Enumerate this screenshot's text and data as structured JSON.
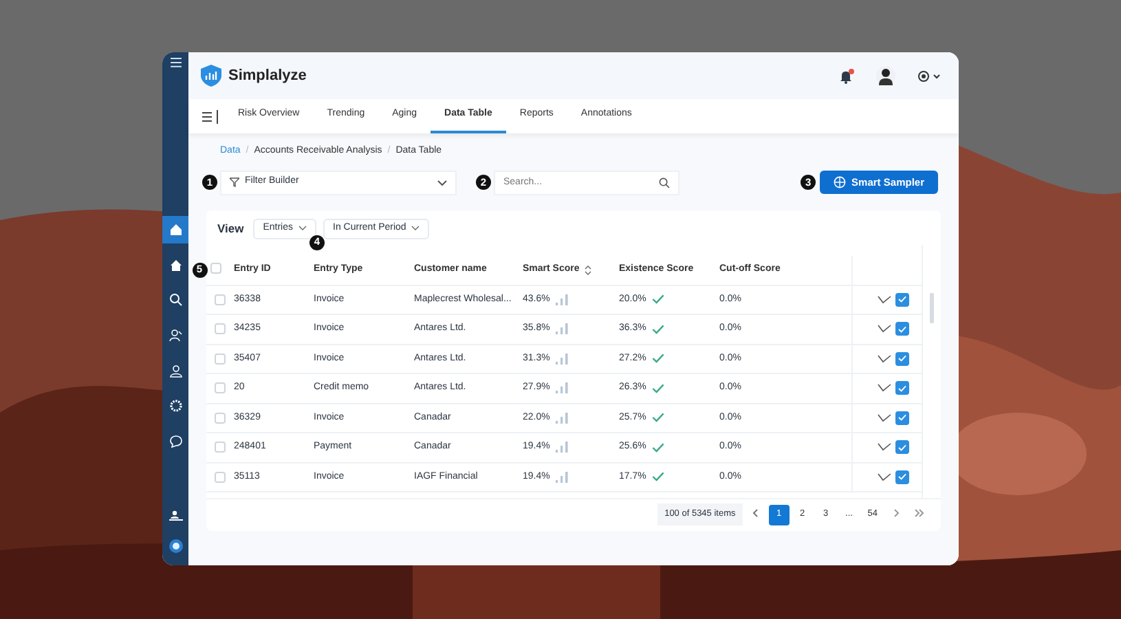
{
  "sidebar": {
    "items": [
      {
        "kind": "top",
        "selected": true
      },
      {
        "kind": "home",
        "selected": false
      },
      {
        "kind": "search",
        "selected": false
      },
      {
        "kind": "users",
        "selected": false
      },
      {
        "kind": "user",
        "selected": false
      },
      {
        "kind": "gear",
        "selected": false
      },
      {
        "kind": "chat",
        "selected": false
      },
      {
        "kind": "people",
        "selected": false
      }
    ]
  },
  "header": {
    "app_name": "Simplalyze",
    "notifications_unread": true
  },
  "tabs": [
    {
      "label": "Risk Overview",
      "selected": false
    },
    {
      "label": "Trending",
      "selected": false
    },
    {
      "label": "Aging",
      "selected": false
    },
    {
      "label": "Data Table",
      "selected": true
    },
    {
      "label": "Reports",
      "selected": false
    },
    {
      "label": "Annotations",
      "selected": false
    }
  ],
  "breadcrumb": {
    "separator": "/",
    "items": [
      "Data",
      "Accounts Receivable Analysis",
      "Data Table"
    ]
  },
  "filter": {
    "label": "Filter Builder"
  },
  "search": {
    "placeholder": "Search..."
  },
  "primary_button": "Smart Sampler",
  "markers": [
    "1",
    "2",
    "3",
    "4",
    "5"
  ],
  "view": {
    "label": "View",
    "dropdowns": [
      "Entries",
      "In Current Period"
    ]
  },
  "table": {
    "select_all_checked": false,
    "columns": [
      {
        "label": "Entry ID",
        "sortable": false
      },
      {
        "label": "Entry Type",
        "sortable": false
      },
      {
        "label": "Customer name",
        "sortable": false
      },
      {
        "label": "Smart Score",
        "sortable": true
      },
      {
        "label": "Existence Score",
        "sortable": false
      },
      {
        "label": "Cut-off Score",
        "sortable": false
      }
    ],
    "rows": [
      {
        "checked": false,
        "cells": [
          "36338",
          "Invoice",
          "Maplecrest Wholesal...",
          "43.6%",
          "20.0%",
          "0.0%"
        ],
        "approved": true
      },
      {
        "checked": false,
        "cells": [
          "34235",
          "Invoice",
          "Antares Ltd.",
          "35.8%",
          "36.3%",
          "0.0%"
        ],
        "approved": true
      },
      {
        "checked": false,
        "cells": [
          "35407",
          "Invoice",
          "Antares Ltd.",
          "31.3%",
          "27.2%",
          "0.0%"
        ],
        "approved": true
      },
      {
        "checked": false,
        "cells": [
          "20",
          "Credit memo",
          "Antares Ltd.",
          "27.9%",
          "26.3%",
          "0.0%"
        ],
        "approved": true
      },
      {
        "checked": false,
        "cells": [
          "36329",
          "Invoice",
          "Canadar",
          "22.0%",
          "25.7%",
          "0.0%"
        ],
        "approved": true
      },
      {
        "checked": false,
        "cells": [
          "248401",
          "Payment",
          "Canadar",
          "19.4%",
          "25.6%",
          "0.0%"
        ],
        "approved": true
      },
      {
        "checked": false,
        "cells": [
          "35113",
          "Invoice",
          "IAGF Financial",
          "19.4%",
          "17.7%",
          "0.0%"
        ],
        "approved": true
      }
    ]
  },
  "pagination": {
    "summary": "100 of 5345 items",
    "pages": [
      {
        "label": "1",
        "selected": true
      },
      {
        "label": "2",
        "selected": false
      },
      {
        "label": "3",
        "selected": false
      },
      {
        "label": "...",
        "selected": false
      },
      {
        "label": "54",
        "selected": false
      }
    ]
  }
}
